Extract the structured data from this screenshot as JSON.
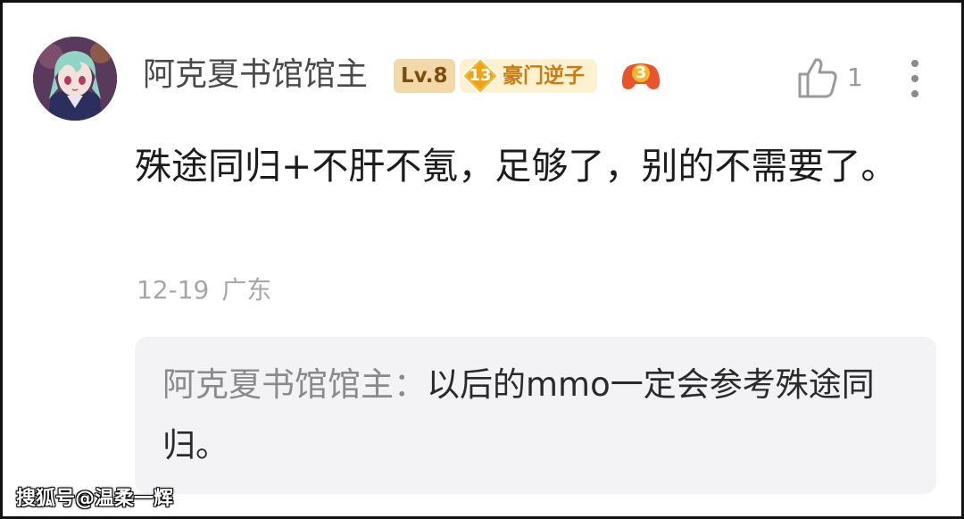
{
  "comment": {
    "username": "阿克夏书馆馆主",
    "level_badge": "Lv.8",
    "title_badge_level": "13",
    "title_badge_text": "豪门逆子",
    "game_badge_number": "3",
    "like_count": "1",
    "text": "殊途同归+不肝不氪，足够了，别的不需要了。",
    "date": "12-19",
    "location": "广东"
  },
  "reply": {
    "author": "阿克夏书馆馆主：",
    "text": "以后的mmo一定会参考殊途同归。"
  },
  "watermark": "搜狐号@温柔一辉",
  "colors": {
    "level_badge_bg": "#f4d9a8",
    "title_badge_bg": "#fdf1d0",
    "title_badge_text": "#c97c14",
    "game_badge": "#e8542b",
    "reply_bg": "#f3f3f5"
  },
  "icons": {
    "avatar": "anime-character-avatar",
    "like": "thumbs-up-icon",
    "more": "vertical-ellipsis-icon",
    "title_badge": "diamond-level-icon",
    "game_badge": "gamepad-icon"
  }
}
